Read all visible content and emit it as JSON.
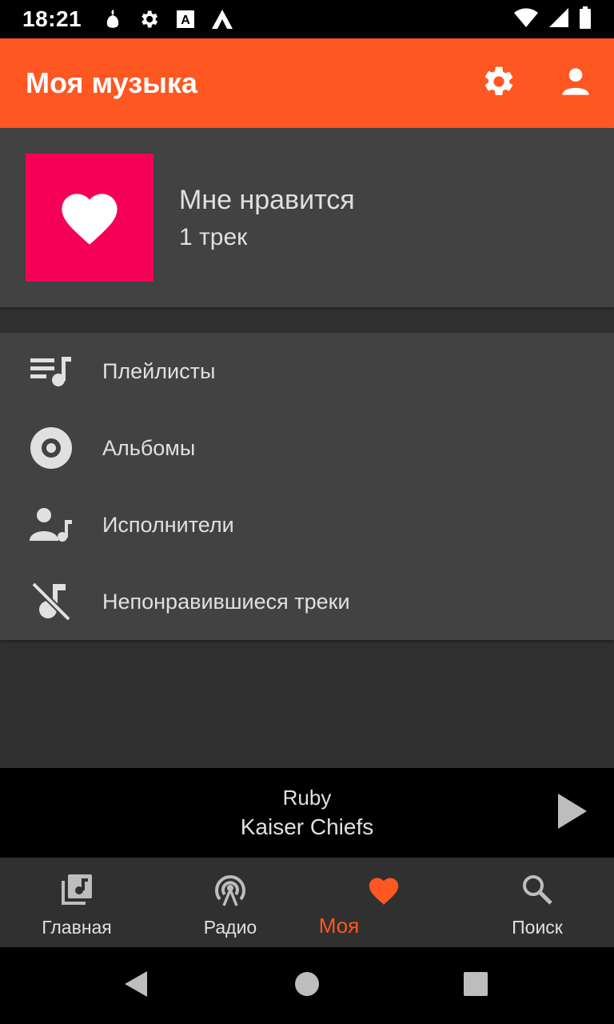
{
  "status_bar": {
    "time": "18:21",
    "notification_icons": [
      "cat-icon",
      "gear-icon",
      "a-icon",
      "arch-icon"
    ],
    "system_icons": [
      "wifi-icon",
      "signal-icon",
      "battery-icon"
    ]
  },
  "app_bar": {
    "title": "Моя музыка",
    "background": "#ff5722",
    "actions": [
      "gear-icon",
      "account-icon"
    ]
  },
  "liked": {
    "title": "Мне нравится",
    "count": "1 трек",
    "cover_color": "#f50057",
    "icon": "heart-icon"
  },
  "menu": {
    "items": [
      {
        "label": "Плейлисты",
        "icon": "playlist-icon"
      },
      {
        "label": "Альбомы",
        "icon": "album-icon"
      },
      {
        "label": "Исполнители",
        "icon": "artist-icon"
      },
      {
        "label": "Непонравившиеся треки",
        "icon": "music-off-icon"
      }
    ]
  },
  "player": {
    "track": "Ruby",
    "artist": "Kaiser Chiefs",
    "button_icon": "play-icon"
  },
  "bottom_nav": {
    "items": [
      {
        "label": "Главная",
        "icon": "library-music-icon",
        "active": false
      },
      {
        "label": "Радио",
        "icon": "radio-tower-icon",
        "active": false
      },
      {
        "label": "Моя",
        "icon": "heart-icon",
        "active": true
      },
      {
        "label": "Поиск",
        "icon": "search-icon",
        "active": false
      }
    ],
    "active_color": "#ff5722"
  },
  "system_nav": [
    "back-icon",
    "home-icon",
    "recents-icon"
  ]
}
